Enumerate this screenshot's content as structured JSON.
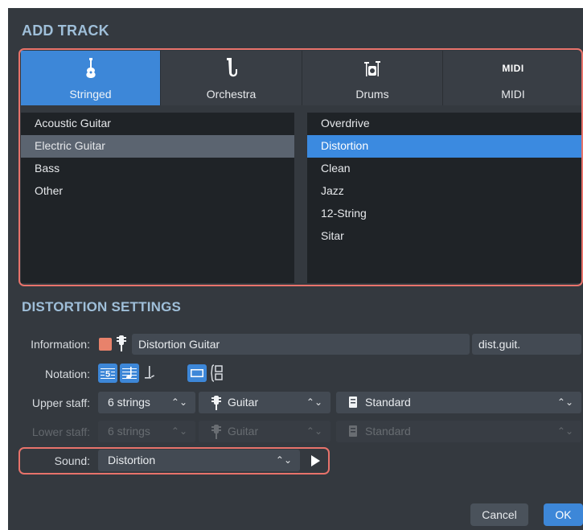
{
  "add_track": {
    "title": "ADD TRACK",
    "tabs": [
      {
        "label": "Stringed",
        "icon": "guitar-icon",
        "active": true
      },
      {
        "label": "Orchestra",
        "icon": "saxophone-icon",
        "active": false
      },
      {
        "label": "Drums",
        "icon": "drum-kit-icon",
        "active": false
      },
      {
        "label": "MIDI",
        "icon": "midi-icon",
        "icon_text": "MIDI",
        "active": false
      }
    ],
    "categories": [
      "Acoustic Guitar",
      "Electric Guitar",
      "Bass",
      "Other"
    ],
    "selected_category": "Electric Guitar",
    "presets": [
      "Overdrive",
      "Distortion",
      "Clean",
      "Jazz",
      "12-String",
      "Sitar"
    ],
    "selected_preset": "Distortion"
  },
  "settings": {
    "title": "DISTORTION SETTINGS",
    "information": {
      "label": "Information:",
      "name_value": "Distortion Guitar",
      "short_name_value": "dist.guit.",
      "color": "#e8826b"
    },
    "notation": {
      "label": "Notation:",
      "tab_glyph": "5"
    },
    "upper_staff": {
      "label": "Upper staff:",
      "strings": "6 strings",
      "instrument": "Guitar",
      "tuning": "Standard"
    },
    "lower_staff": {
      "label": "Lower staff:",
      "strings": "6 strings",
      "instrument": "Guitar",
      "tuning": "Standard"
    },
    "sound": {
      "label": "Sound:",
      "value": "Distortion"
    }
  },
  "footer": {
    "cancel_label": "Cancel",
    "ok_label": "OK"
  },
  "colors": {
    "accent": "#3d87d8",
    "highlight": "#e8736b",
    "section_title": "#9fbfd9"
  }
}
